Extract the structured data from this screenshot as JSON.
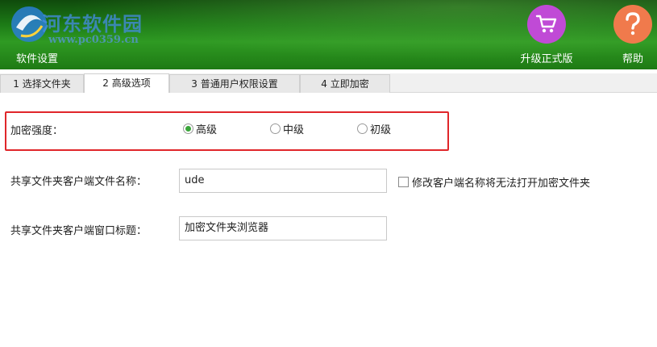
{
  "header": {
    "watermark_text": "河东软件园",
    "watermark_url": "www.pc0359.cn",
    "settings_label": "软件设置",
    "upgrade_label": "升级正式版",
    "help_label": "帮助",
    "colors": {
      "upgrade": "#c04ad6",
      "help": "#f07a4c",
      "header_green": "#1c7a16"
    }
  },
  "tabs": [
    {
      "label": "1 选择文件夹",
      "active": false
    },
    {
      "label": "2 高级选项",
      "active": true
    },
    {
      "label": "3 普通用户权限设置",
      "active": false
    },
    {
      "label": "4 立即加密",
      "active": false
    }
  ],
  "encryption": {
    "label": "加密强度：",
    "options": [
      {
        "label": "高级",
        "checked": true
      },
      {
        "label": "中级",
        "checked": false
      },
      {
        "label": "初级",
        "checked": false
      }
    ]
  },
  "client_name": {
    "label": "共享文件夹客户端文件名称：",
    "value": "ude",
    "checkbox_label": "修改客户端名称将无法打开加密文件夹",
    "checkbox_checked": false
  },
  "window_title": {
    "label": "共享文件夹客户端窗口标题：",
    "value": "加密文件夹浏览器"
  }
}
